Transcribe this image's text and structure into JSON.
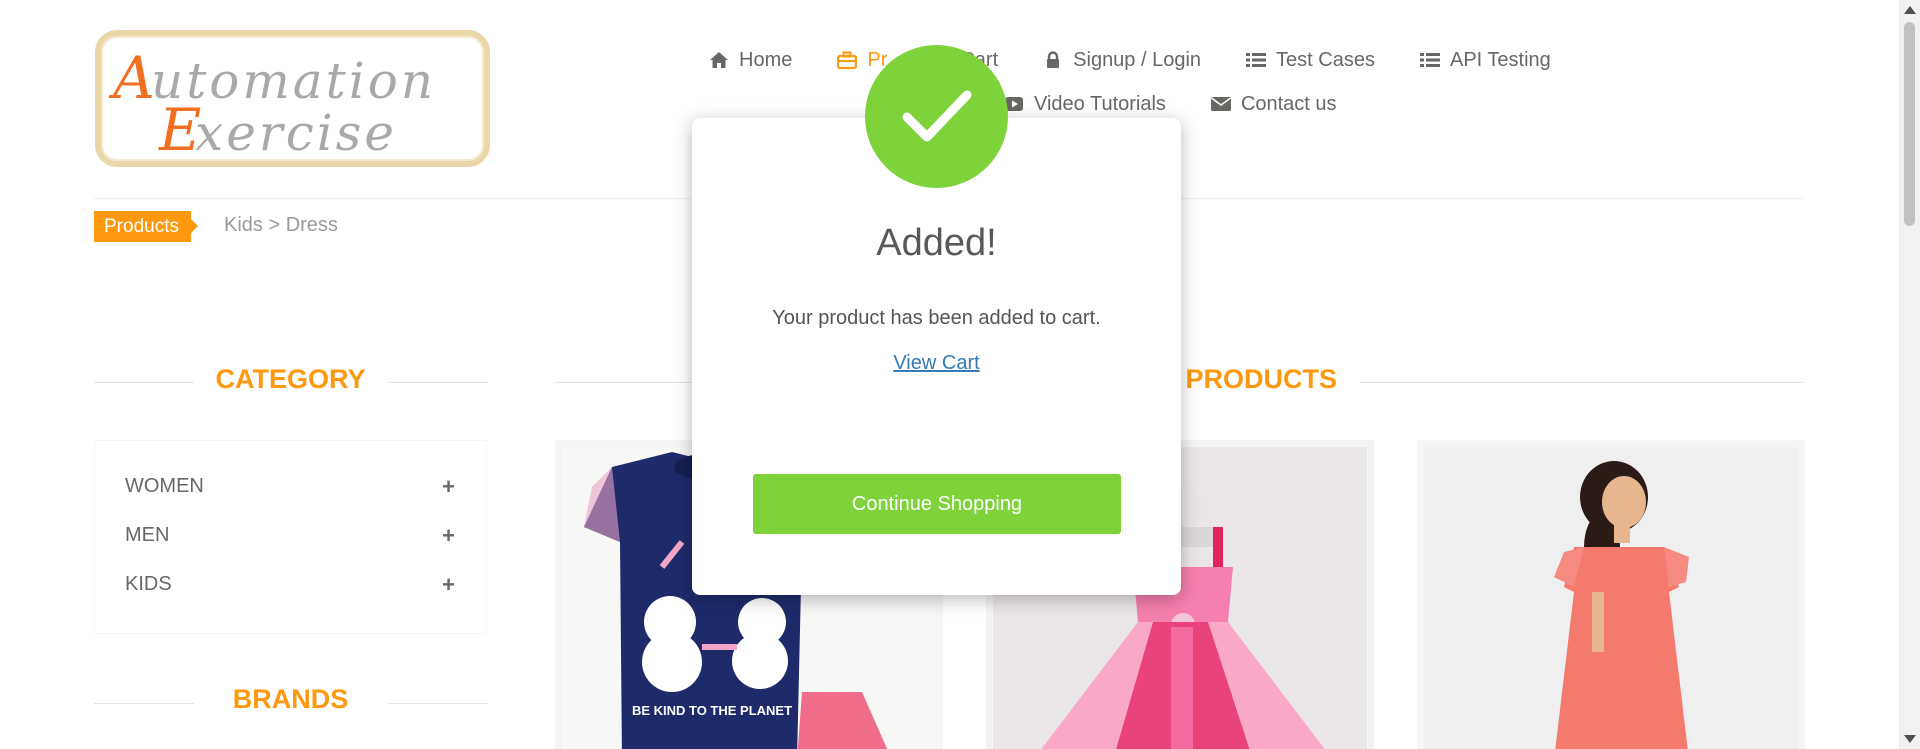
{
  "logo": {
    "line1": "Automation",
    "line2": "Exercise"
  },
  "nav": {
    "row1": [
      {
        "label": "Home",
        "icon": "home-icon"
      },
      {
        "label": "Products",
        "icon": "briefcase-icon",
        "active": true
      },
      {
        "label": "Cart",
        "icon": "cart-icon"
      },
      {
        "label": "Signup / Login",
        "icon": "lock-icon"
      },
      {
        "label": "Test Cases",
        "icon": "list-icon"
      },
      {
        "label": "API Testing",
        "icon": "list-icon"
      }
    ],
    "row2": [
      {
        "label": "Video Tutorials",
        "icon": "youtube-icon"
      },
      {
        "label": "Contact us",
        "icon": "envelope-icon"
      }
    ]
  },
  "breadcrumb": {
    "active": "Products",
    "rest": "Kids > Dress"
  },
  "sidebar": {
    "category_title": "Category",
    "categories": [
      "WOMEN",
      "MEN",
      "KIDS"
    ],
    "brands_title": "Brands"
  },
  "main": {
    "title_visible": "S PRODUCTS"
  },
  "modal": {
    "title": "Added!",
    "message": "Your product has been added to cart.",
    "link": "View Cart",
    "button": "Continue Shopping"
  },
  "products": [
    {
      "tshirt_text": "BE KIND TO THE PLANET"
    }
  ],
  "colors": {
    "accent": "#fe980f",
    "success": "#7ed33a",
    "text": "#696763",
    "link": "#337ab7"
  }
}
